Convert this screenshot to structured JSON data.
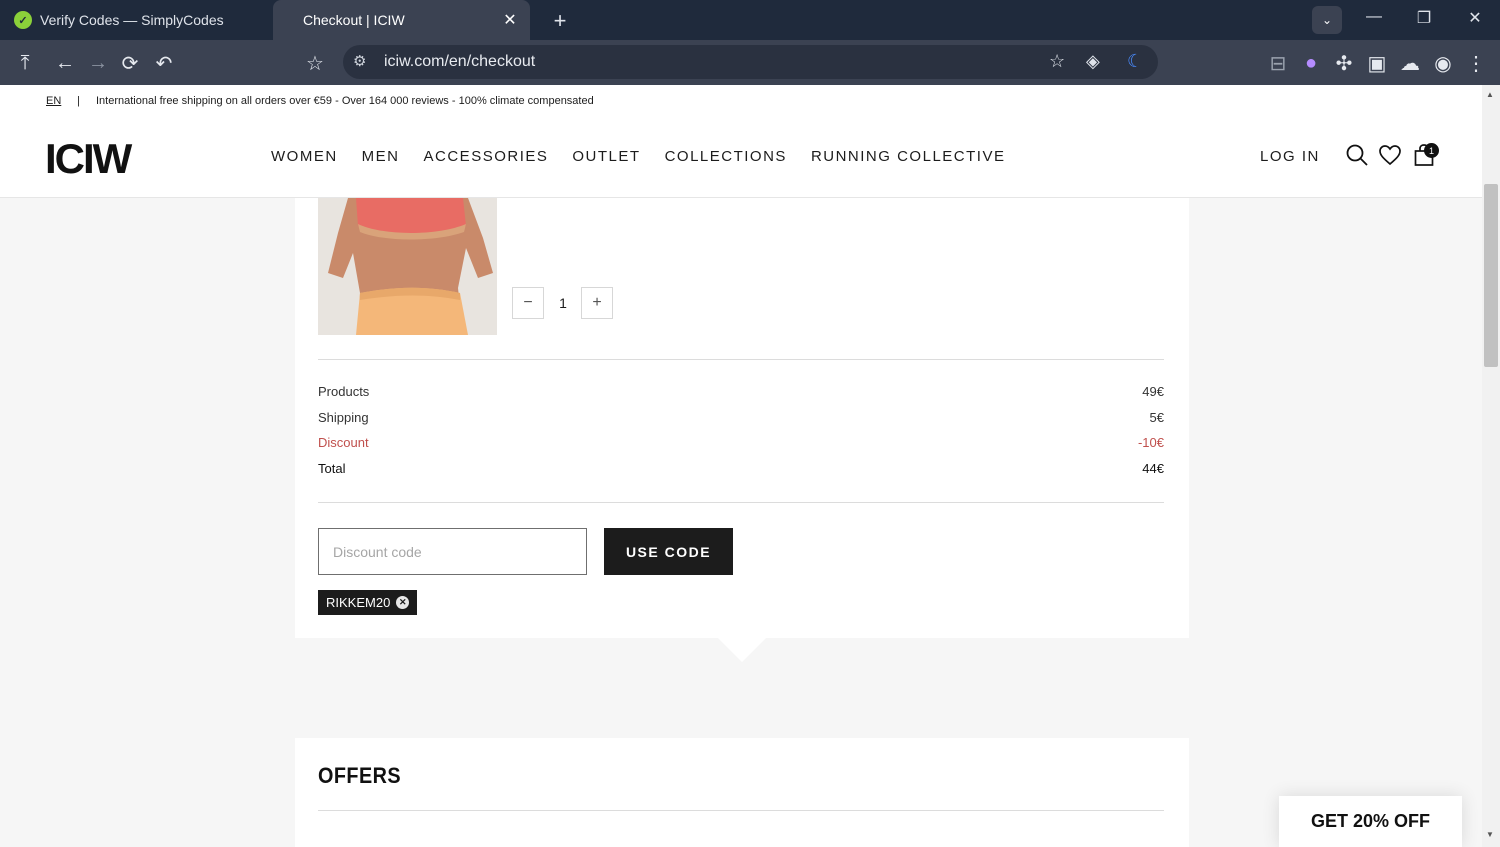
{
  "browser": {
    "tabs": [
      {
        "title": "Verify Codes — SimplyCodes",
        "active": false
      },
      {
        "title": "Checkout | ICIW",
        "active": true
      }
    ],
    "url": "iciw.com/en/checkout"
  },
  "promo": {
    "lang": "EN",
    "separator": "|",
    "message": "International free shipping on all orders over €59 - Over 164 000 reviews - 100% climate compensated"
  },
  "header": {
    "logo": "ICIW",
    "nav": [
      "WOMEN",
      "MEN",
      "ACCESSORIES",
      "OUTLET",
      "COLLECTIONS",
      "RUNNING COLLECTIVE"
    ],
    "login": "LOG IN",
    "cart_count": "1"
  },
  "cart": {
    "quantity": "1",
    "minus": "−",
    "plus": "+"
  },
  "summary": [
    {
      "label": "Products",
      "value": "49€"
    },
    {
      "label": "Shipping",
      "value": "5€"
    },
    {
      "label": "Discount",
      "value": "-10€"
    },
    {
      "label": "Total",
      "value": "44€"
    }
  ],
  "discount": {
    "placeholder": "Discount code",
    "button": "USE CODE",
    "applied_code": "RIKKEM20"
  },
  "offers": {
    "title": "OFFERS"
  },
  "popup": {
    "label": "GET 20% OFF"
  },
  "colors": {
    "accent": "#1c1c1c",
    "discount": "#c0504d",
    "tabstrip": "#1f2a3c"
  }
}
